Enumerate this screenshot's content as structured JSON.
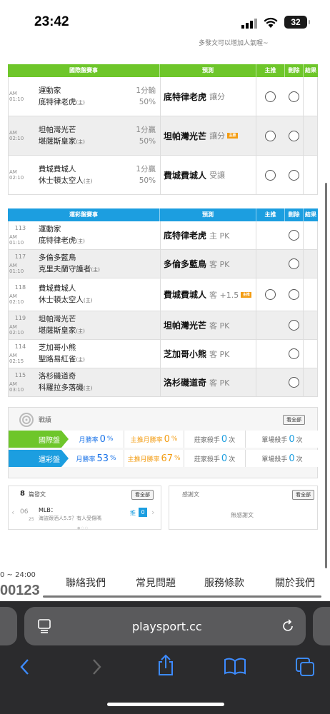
{
  "status": {
    "time": "23:42",
    "battery": "32"
  },
  "top_note": "多發文可以增加人氣喔~",
  "intl_table": {
    "headers": [
      "國際盤賽事",
      "預測",
      "主推",
      "刪除",
      "結果"
    ],
    "header_color": "#6ec62a",
    "rows": [
      {
        "time": "AM 01:10",
        "away": "運動家",
        "home": "底特律老虎",
        "home_mark": "(主)",
        "res1": "1分輸",
        "res2": "50%",
        "pick": "底特律老虎",
        "pick_sub": "讓分",
        "flag": false,
        "has_main": true
      },
      {
        "time": "AM 02:10",
        "away": "坦帕灣光芒",
        "home": "堪薩斯皇家",
        "home_mark": "(主)",
        "res1": "1分贏",
        "res2": "50%",
        "pick": "坦帕灣光芒",
        "pick_sub": "讓分",
        "flag": true,
        "has_main": true
      },
      {
        "time": "AM 02:10",
        "away": "費城費城人",
        "home": "休士頓太空人",
        "home_mark": "(主)",
        "res1": "1分贏",
        "res2": "50%",
        "pick": "費城費城人",
        "pick_sub": "受讓",
        "flag": false,
        "has_main": true
      }
    ]
  },
  "lottery_table": {
    "headers": [
      "運彩盤賽事",
      "預測",
      "主推",
      "刪除",
      "結果"
    ],
    "header_color": "#1c9ee0",
    "rows": [
      {
        "num": "113",
        "time": "AM 01:10",
        "away": "運動家",
        "home": "底特律老虎",
        "home_mark": "(主)",
        "pick": "底特律老虎",
        "pick_sub": "主 PK",
        "flag": false,
        "has_main": false
      },
      {
        "num": "117",
        "time": "AM 01:10",
        "away": "多倫多藍鳥",
        "home": "克里夫蘭守護者",
        "home_mark": "(主)",
        "pick": "多倫多藍鳥",
        "pick_sub": "客 PK",
        "flag": false,
        "has_main": false
      },
      {
        "num": "118",
        "time": "AM 02:10",
        "away": "費城費城人",
        "home": "休士頓太空人",
        "home_mark": "(主)",
        "pick": "費城費城人",
        "pick_sub": "客 +1.5",
        "flag": true,
        "has_main": true
      },
      {
        "num": "119",
        "time": "AM 02:10",
        "away": "坦帕灣光芒",
        "home": "堪薩斯皇家",
        "home_mark": "(主)",
        "pick": "坦帕灣光芒",
        "pick_sub": "客 PK",
        "flag": false,
        "has_main": false
      },
      {
        "num": "114",
        "time": "AM 02:15",
        "away": "芝加哥小熊",
        "home": "聖路易紅雀",
        "home_mark": "(主)",
        "pick": "芝加哥小熊",
        "pick_sub": "客 PK",
        "flag": false,
        "has_main": false
      },
      {
        "num": "115",
        "time": "AM 03:10",
        "away": "洛杉磯道奇",
        "home": "科羅拉多落磯",
        "home_mark": "(主)",
        "pick": "洛杉磯道奇",
        "pick_sub": "客 PK",
        "flag": false,
        "has_main": false
      }
    ]
  },
  "record": {
    "title": "戰績",
    "view_all": "看全部",
    "intl": {
      "label": "國際盤",
      "monthly_label": "月勝率",
      "monthly": "0",
      "main_label": "主推月勝率",
      "main": "0",
      "zhuang_label": "莊家殺手",
      "zhuang": "0",
      "single_label": "單場殺手",
      "single": "0",
      "unit_pct": "%",
      "unit_times": "次",
      "color": "#6ec62a"
    },
    "lottery": {
      "label": "運彩盤",
      "monthly_label": "月勝率",
      "monthly": "53",
      "main_label": "主推月勝率",
      "main": "67",
      "zhuang_label": "莊家殺手",
      "zhuang": "0",
      "single_label": "單場殺手",
      "single": "0",
      "unit_pct": "%",
      "unit_times": "次",
      "color": "#1c9ee0"
    }
  },
  "posts": {
    "count": "8",
    "label": "篇發文",
    "view_all": "看全部",
    "month": "06",
    "day": "25",
    "cat": "MLB：",
    "text": "海盜跟洒人5.5？有人受傷嗎",
    "push": "推",
    "push_count": "0"
  },
  "thanks": {
    "title": "感謝文",
    "view_all": "看全部",
    "empty": "無感謝文"
  },
  "footer": {
    "hours": "0 ~ 24:00",
    "phone": "00123",
    "links": [
      "聯絡我們",
      "常見問題",
      "服務條款",
      "關於我們"
    ]
  },
  "browser": {
    "url": "playsport.cc"
  }
}
